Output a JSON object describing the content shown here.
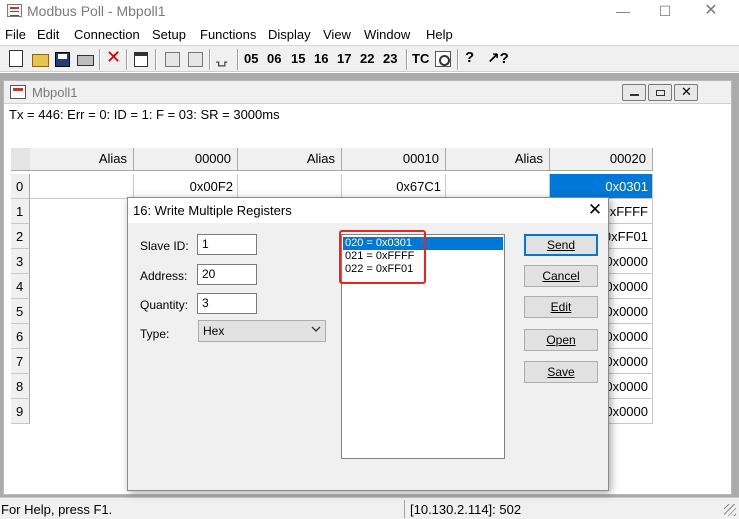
{
  "window": {
    "title": "Modbus Poll - Mbpoll1"
  },
  "menu": [
    "File",
    "Edit",
    "Connection",
    "Setup",
    "Functions",
    "Display",
    "View",
    "Window",
    "Help"
  ],
  "toolbar": {
    "function_codes": [
      "05",
      "06",
      "15",
      "16",
      "17",
      "22",
      "23"
    ],
    "tc_label": "TC"
  },
  "child": {
    "title": "Mbpoll1",
    "status_line": "Tx = 446: Err = 0: ID = 1: F = 03: SR = 3000ms"
  },
  "grid": {
    "headers": [
      "Alias",
      "00000",
      "Alias",
      "00010",
      "Alias",
      "00020"
    ],
    "rows": [
      {
        "n": "0",
        "c1": "0x00F2",
        "c3": "0x67C1",
        "c5": "0x0301"
      },
      {
        "n": "1",
        "c5": "0xFFFF"
      },
      {
        "n": "2",
        "c5": "0xFF01"
      },
      {
        "n": "3",
        "c5": "0x0000"
      },
      {
        "n": "4",
        "c5": "0x0000"
      },
      {
        "n": "5",
        "c5": "0x0000"
      },
      {
        "n": "6",
        "c5": "0x0000"
      },
      {
        "n": "7",
        "c5": "0x0000"
      },
      {
        "n": "8",
        "c5": "0x0000"
      },
      {
        "n": "9",
        "c5": "0x0000"
      }
    ]
  },
  "dialog": {
    "title": "16: Write Multiple Registers",
    "slave_id_label": "Slave ID:",
    "slave_id": "1",
    "address_label": "Address:",
    "address": "20",
    "quantity_label": "Quantity:",
    "quantity": "3",
    "type_label": "Type:",
    "type_value": "Hex",
    "registers": [
      "020 = 0x0301",
      "021 = 0xFFFF",
      "022 = 0xFF01"
    ],
    "buttons": {
      "send": "Send",
      "cancel": "Cancel",
      "edit": "Edit",
      "open": "Open",
      "save": "Save"
    }
  },
  "statusbar": {
    "help": "For Help, press F1.",
    "connection": "[10.130.2.114]: 502"
  },
  "colors": {
    "selection": "#0078d7",
    "highlight_box": "#e8251f"
  }
}
